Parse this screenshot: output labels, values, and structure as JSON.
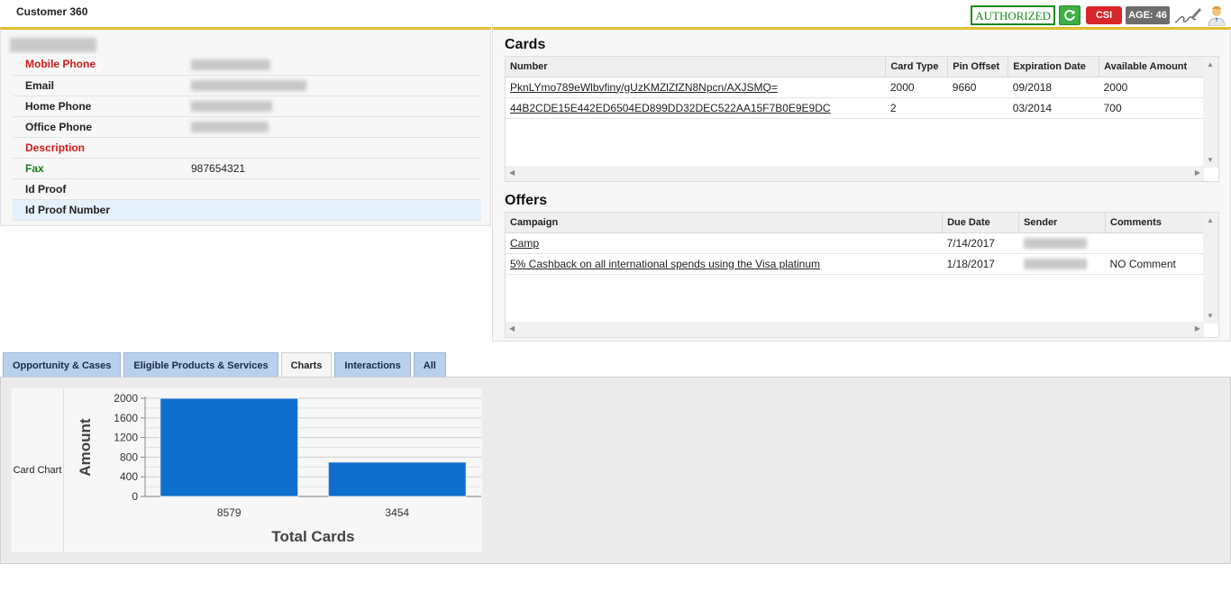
{
  "page": {
    "title": "Customer 360"
  },
  "badges": {
    "authorized": "AUTHORIZED",
    "csi": "CSI",
    "age": "AGE: 46"
  },
  "contact": {
    "rows": [
      {
        "label": "Mobile Phone",
        "value": "",
        "color": "#d11a1a"
      },
      {
        "label": "Email",
        "value": "",
        "color": "#222222"
      },
      {
        "label": "Home Phone",
        "value": "",
        "color": "#222222"
      },
      {
        "label": "Office Phone",
        "value": "",
        "color": "#222222"
      },
      {
        "label": "Description",
        "value": "",
        "color": "#d11a1a"
      },
      {
        "label": "Fax",
        "value": "987654321",
        "color": "#1d7a1d"
      },
      {
        "label": "Id Proof",
        "value": "",
        "color": "#222222"
      },
      {
        "label": "Id Proof Number",
        "value": "",
        "color": "#222222"
      }
    ]
  },
  "cards": {
    "title": "Cards",
    "columns": [
      "Number",
      "Card Type",
      "Pin Offset",
      "Expiration Date",
      "Available Amount"
    ],
    "rows": [
      {
        "number": "PknLYmo789eWlbvfiny/gUzKMZlZfZN8Npcn/AXJSMQ=",
        "card_type": "2000",
        "pin_offset": "9660",
        "expiration": "09/2018",
        "available": "2000"
      },
      {
        "number": "44B2CDE15E442ED6504ED899DD32DEC522AA15F7B0E9E9DC",
        "card_type": "2",
        "pin_offset": "",
        "expiration": "03/2014",
        "available": "700"
      }
    ]
  },
  "offers": {
    "title": "Offers",
    "columns": [
      "Campaign",
      "Due Date",
      "Sender",
      "Comments"
    ],
    "rows": [
      {
        "campaign": "Camp",
        "due_date": "7/14/2017",
        "sender": "",
        "comments": ""
      },
      {
        "campaign": "5% Cashback on all international spends using the Visa platinum",
        "due_date": "1/18/2017",
        "sender": "",
        "comments": "NO Comment"
      }
    ]
  },
  "tabs": [
    {
      "label": "Opportunity & Cases",
      "active": false
    },
    {
      "label": "Eligible Products & Services",
      "active": false
    },
    {
      "label": "Charts",
      "active": true
    },
    {
      "label": "Interactions",
      "active": false
    },
    {
      "label": "All",
      "active": false
    }
  ],
  "chart_panel": {
    "side_label": "Card Chart"
  },
  "chart_data": {
    "type": "bar",
    "categories": [
      "8579",
      "3454"
    ],
    "values": [
      2000,
      700
    ],
    "title": "",
    "xlabel": "Total Cards",
    "ylabel": "Amount",
    "ylim": [
      0,
      2000
    ],
    "yticks": [
      0,
      400,
      800,
      1200,
      1600,
      2000
    ],
    "grid": true,
    "color": "#0e6fcf"
  },
  "colors": {
    "accent": "#e4bd2e",
    "tab": "#b8d0ec"
  }
}
